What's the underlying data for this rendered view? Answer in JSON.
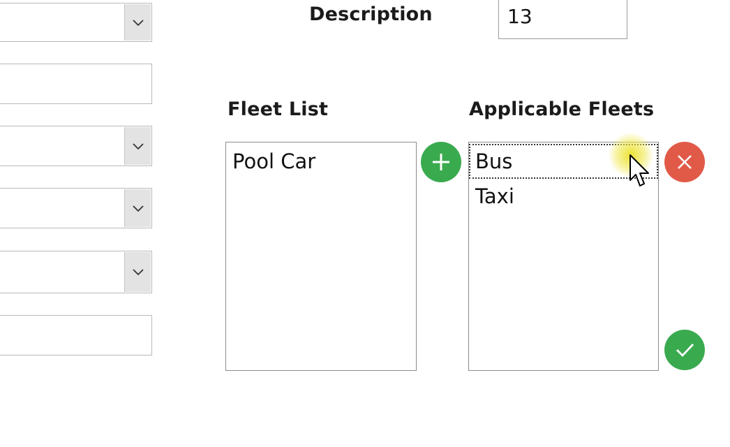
{
  "form": {
    "description_label": "Description",
    "description_value": "13"
  },
  "fleet_list": {
    "label": "Fleet List",
    "items": [
      "Pool Car"
    ]
  },
  "applicable_fleets": {
    "label": "Applicable Fleets",
    "items": [
      "Bus",
      "Taxi"
    ],
    "focused_item": "Bus"
  },
  "buttons": {
    "add_icon": "plus-icon",
    "remove_icon": "close-icon",
    "confirm_icon": "check-icon"
  },
  "colors": {
    "add": "#3aaa4f",
    "remove": "#e15a48",
    "confirm": "#3aaa4f",
    "cursor_highlight": "#ece12a"
  }
}
